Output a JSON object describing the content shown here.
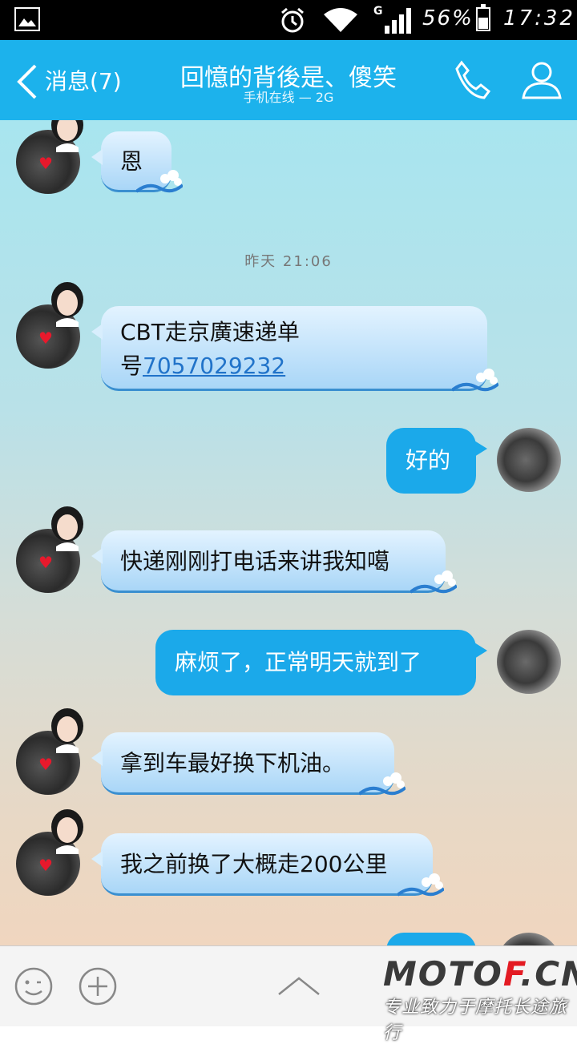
{
  "status": {
    "signal_type": "G",
    "battery": "56%",
    "time": "17:32"
  },
  "header": {
    "back_label": "消息(7)",
    "title": "回憶的背後是、傻笑",
    "subtitle": "手机在线 — 2G"
  },
  "chat": {
    "timestamp": "昨天 21:06",
    "messages": [
      {
        "side": "in",
        "text": "恩"
      },
      {
        "side": "in",
        "text_line1": "CBT走京廣速递单",
        "text_prefix": "号",
        "link": "7057029232"
      },
      {
        "side": "out",
        "text": "好的"
      },
      {
        "side": "in",
        "text": "快递刚刚打电话来讲我知噶"
      },
      {
        "side": "out",
        "text": "麻烦了，正常明天就到了"
      },
      {
        "side": "in",
        "text": "拿到车最好换下机油。"
      },
      {
        "side": "in",
        "text": "我之前换了大概走200公里"
      }
    ]
  },
  "watermark": {
    "logo_a": "MOTO",
    "logo_b": "F",
    "logo_c": ".CN",
    "tagline": "专业致力于摩托长途旅行"
  },
  "colors": {
    "accent": "#1cb2ec",
    "out_bubble": "#1ba9ea"
  }
}
